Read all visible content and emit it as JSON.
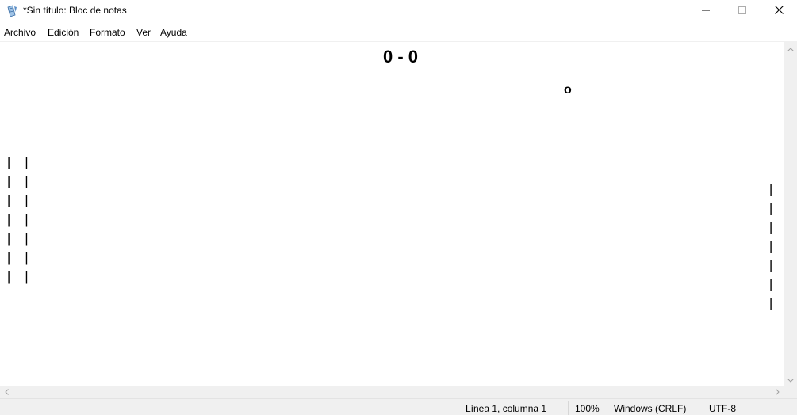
{
  "window": {
    "title": "*Sin título: Bloc de notas",
    "icon": "notepad-icon",
    "controls": {
      "minimize": "minimize-icon",
      "maximize": "maximize-icon",
      "close": "close-icon"
    }
  },
  "menu": {
    "items": [
      "Archivo",
      "Edición",
      "Formato",
      "Ver",
      "Ayuda"
    ]
  },
  "editor": {
    "score": "0 - 0",
    "ball": "o",
    "left_paddle": "| |\n| |\n| |\n| |\n| |\n| |\n| |",
    "right_paddle": "| |\n| |\n| |\n| |\n| |\n| |\n| |"
  },
  "status": {
    "position": "Línea 1, columna 1",
    "zoom": "100%",
    "line_ending": "Windows (CRLF)",
    "encoding": "UTF-8"
  }
}
